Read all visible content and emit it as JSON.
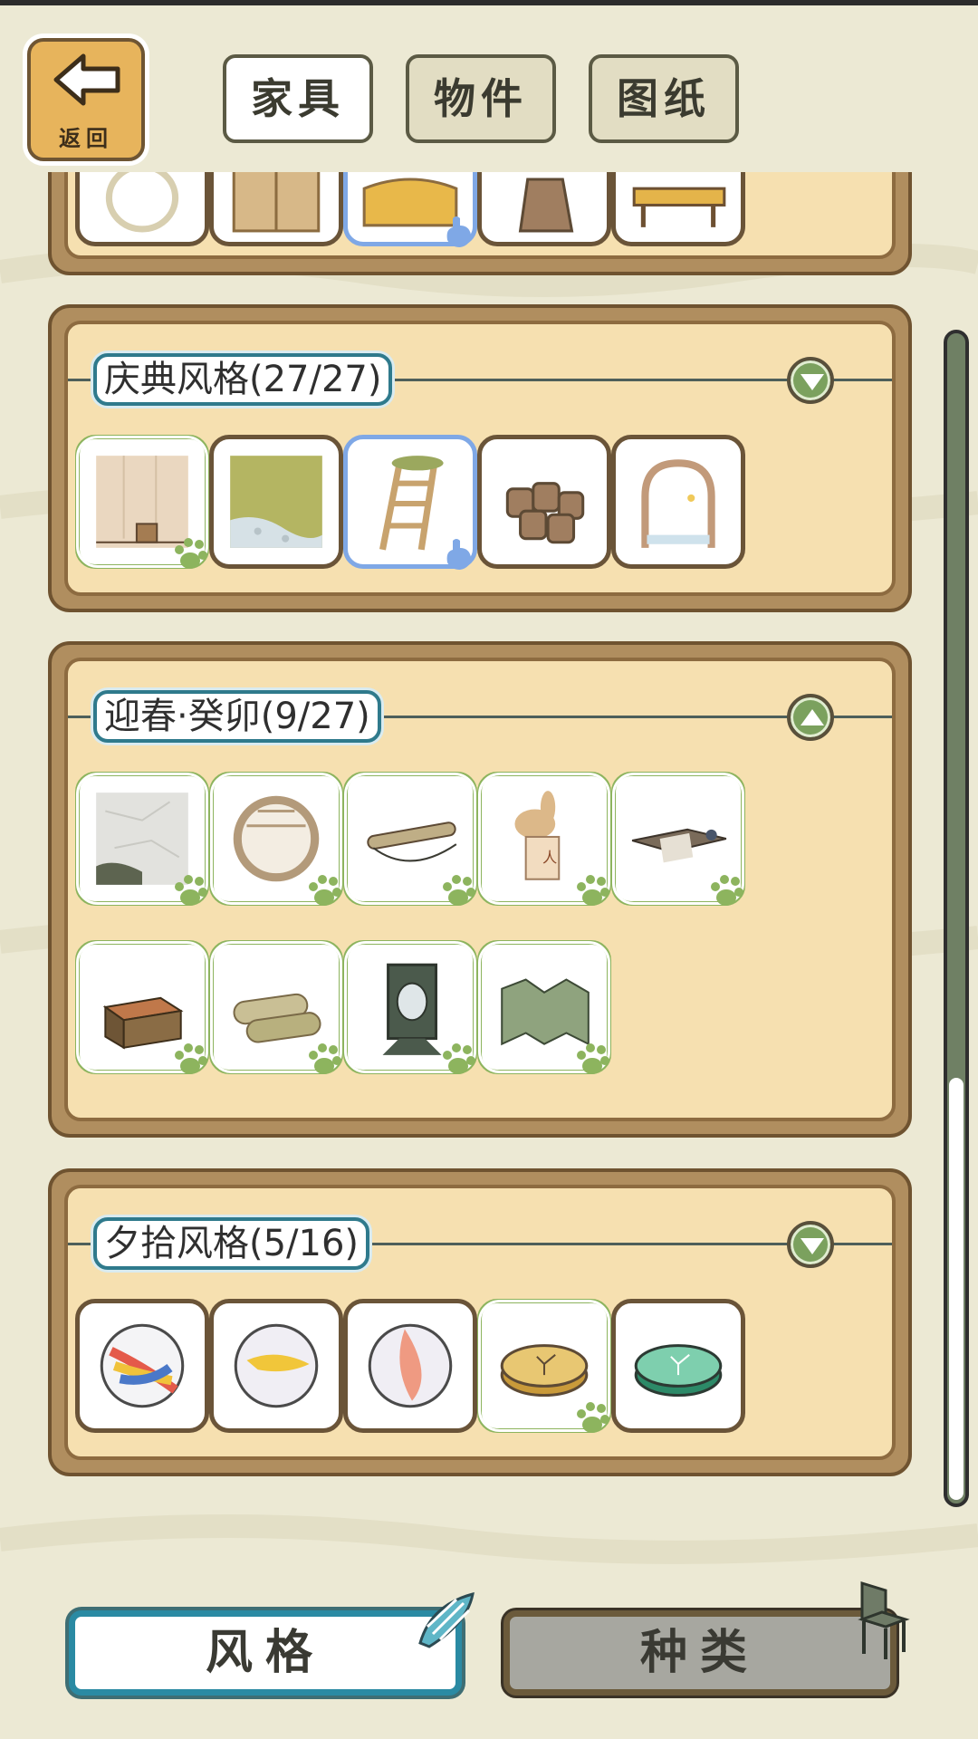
{
  "header": {
    "back_label": "返回",
    "tabs": [
      {
        "label": "家具",
        "active": true
      },
      {
        "label": "物件",
        "active": false
      },
      {
        "label": "图纸",
        "active": false
      }
    ]
  },
  "sections": [
    {
      "title": "",
      "expanded": false,
      "items": [
        "round-mirror-item",
        "wooden-door-item",
        "golden-blanket-item",
        "tan-bag-item",
        "golden-table-item"
      ]
    },
    {
      "title": "庆典风格(27/27)",
      "expanded": false,
      "items": [
        "wooden-wall-item",
        "grass-floor-item",
        "ladder-item",
        "barrels-item",
        "arched-window-item"
      ]
    },
    {
      "title": "迎春·癸卯(9/27)",
      "expanded": true,
      "items": [
        "stone-floor-item",
        "round-window-item",
        "scroll-rod-item",
        "rabbit-calendar-item",
        "low-desk-item",
        "wooden-chest-item",
        "rolled-mats-item",
        "standing-mirror-item",
        "folding-screen-item"
      ]
    },
    {
      "title": "夕拾风格(5/16)",
      "expanded": false,
      "items": [
        "tricolor-marble-item",
        "yellow-marble-item",
        "pink-marble-item",
        "gold-coin-item",
        "green-coin-item"
      ]
    }
  ],
  "bottom": {
    "style_label": "风格",
    "type_label": "种类"
  },
  "colors": {
    "background": "#ece9d4",
    "panel": "#f6e0b0",
    "owned_border": "#8db45e",
    "selected_border": "#7fa8e6",
    "title_border": "#2f7a8c"
  }
}
